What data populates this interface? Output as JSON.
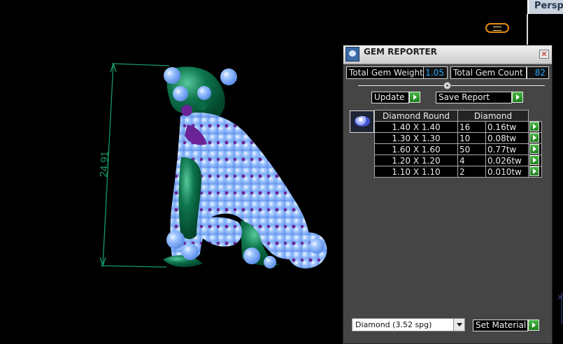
{
  "viewport": {
    "tab_label": "Persp",
    "dimension_label": "24.91",
    "colors": {
      "dimension": "#139865",
      "dog_body": "#0b6a47",
      "gem_light": "#8cb8ff",
      "gem_dark": "#6b2396"
    }
  },
  "gem_reporter": {
    "title": "GEM REPORTER",
    "close_label": "✕",
    "total_gem_weight_label": "Total Gem Weight",
    "total_gem_weight_value": "1.05",
    "total_gem_count_label": "Total Gem Count",
    "total_gem_count_value": "82",
    "update_label": "Update",
    "save_report_label": "Save Report",
    "table": {
      "columns": [
        "Diamond Round",
        "Diamond"
      ],
      "rows": [
        {
          "size": "1.40 X 1.40",
          "count": "16",
          "weight": "0.16tw"
        },
        {
          "size": "1.30 X 1.30",
          "count": "10",
          "weight": "0.08tw"
        },
        {
          "size": "1.60 X 1.60",
          "count": "50",
          "weight": "0.77tw"
        },
        {
          "size": "1.20 X 1.20",
          "count": "4",
          "weight": "0.026tw"
        },
        {
          "size": "1.10 X 1.10",
          "count": "2",
          "weight": "0.010tw"
        }
      ]
    },
    "material": {
      "selected": "Diamond     (3.52 spg)"
    },
    "set_material_label": "Set Material"
  },
  "icons": {
    "gem_reporter_icon": "gem-reporter-icon",
    "camera_icon": "camera-icon",
    "axis_icon": "axis-icon",
    "diamond_thumbnail": "diamond-thumbnail"
  }
}
